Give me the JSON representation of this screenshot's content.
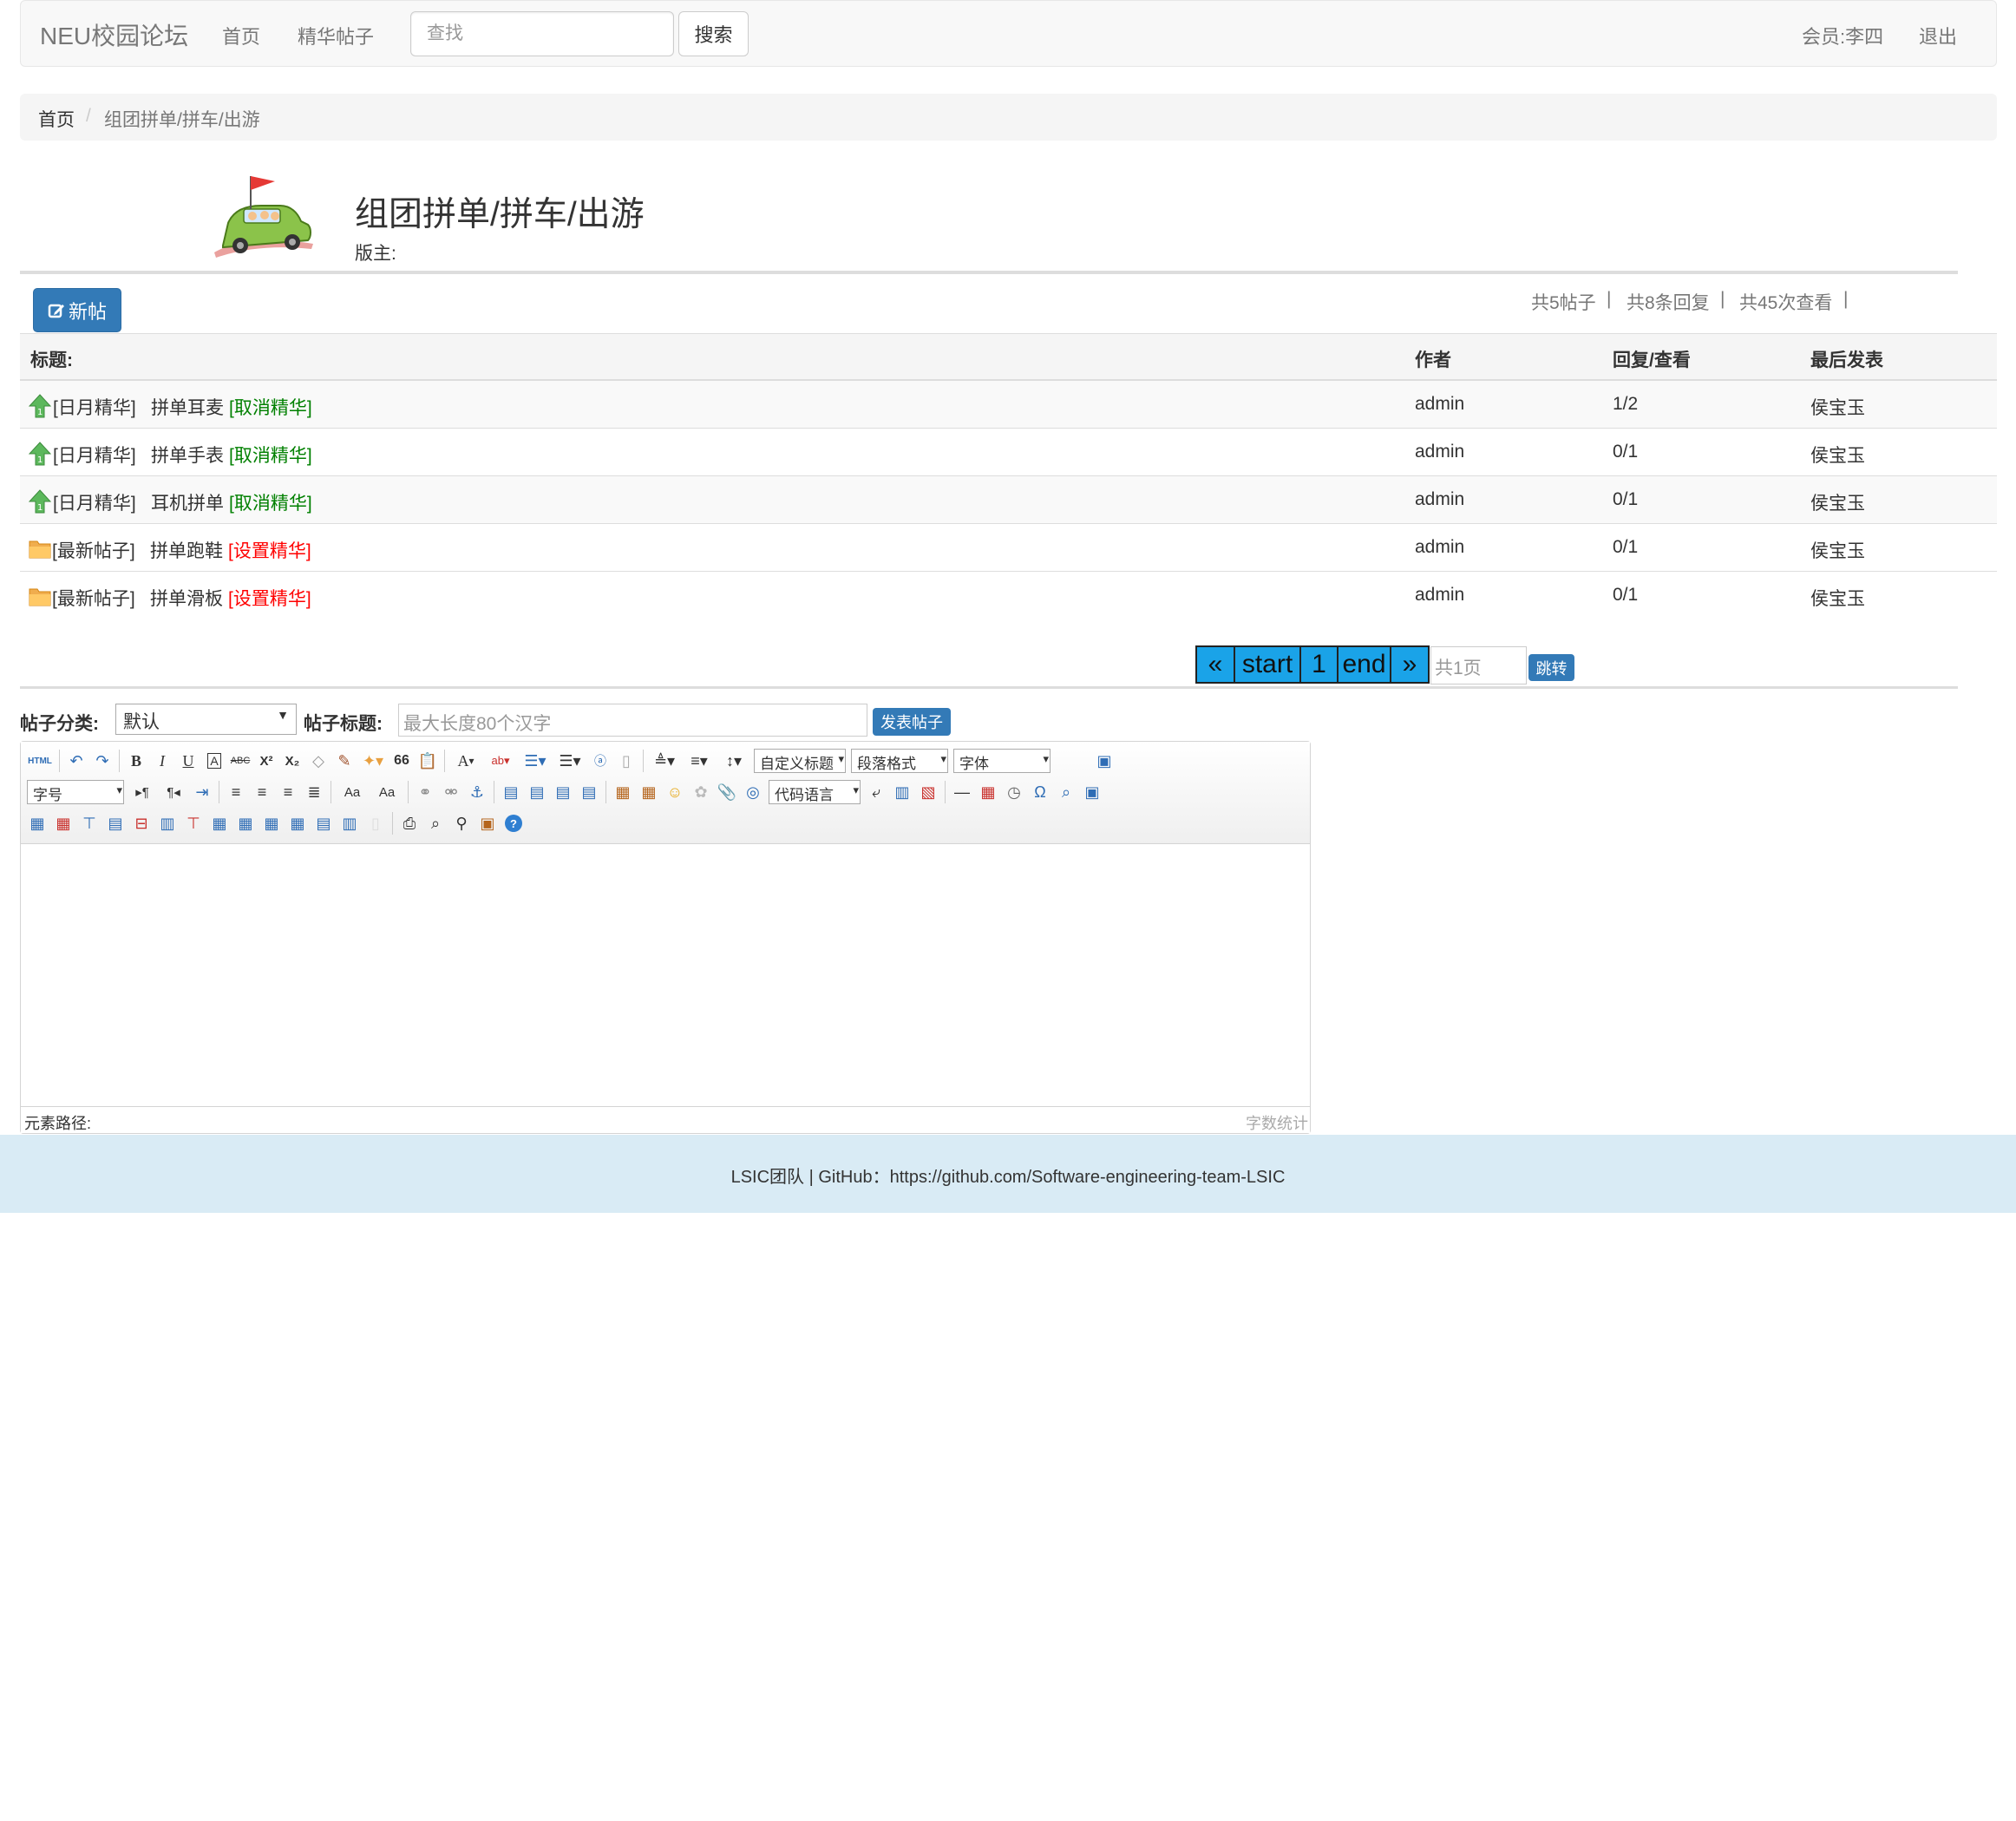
{
  "nav": {
    "brand": "NEU校园论坛",
    "home": "首页",
    "featured": "精华帖子",
    "search_placeholder": "查找",
    "search_button": "搜索",
    "member": "会员:李四",
    "logout": "退出"
  },
  "breadcrumb": {
    "home": "首页",
    "separator": "/",
    "current": "组团拼单/拼车/出游"
  },
  "board": {
    "title": "组团拼单/拼车/出游",
    "moderator": "版主:"
  },
  "toolbar": {
    "new_post": "新帖",
    "stats": [
      "共5帖子",
      "共8条回复",
      "共45次查看"
    ],
    "stat_separator": "|"
  },
  "table": {
    "headers": {
      "title": "标题:",
      "author": "作者",
      "reply_view": "回复/查看",
      "last_post": "最后发表"
    },
    "rows": [
      {
        "tag": "[日月精华]",
        "title": "拼单耳麦",
        "action": "[取消精华]",
        "author": "admin",
        "replies": "1/2",
        "last": "侯宝玉",
        "icon": "featured-up-arrow-icon"
      },
      {
        "tag": "[日月精华]",
        "title": "拼单手表",
        "action": "[取消精华]",
        "author": "admin",
        "replies": "0/1",
        "last": "侯宝玉",
        "icon": "featured-up-arrow-icon"
      },
      {
        "tag": "[日月精华]",
        "title": "耳机拼单",
        "action": "[取消精华]",
        "author": "admin",
        "replies": "0/1",
        "last": "侯宝玉",
        "icon": "featured-up-arrow-icon"
      },
      {
        "tag": "[最新帖子]",
        "title": "拼单跑鞋",
        "action": "[设置精华]",
        "author": "admin",
        "replies": "0/1",
        "last": "侯宝玉",
        "icon": "folder-icon"
      },
      {
        "tag": "[最新帖子]",
        "title": "拼单滑板",
        "action": "[设置精华]",
        "author": "admin",
        "replies": "0/1",
        "last": "侯宝玉",
        "icon": "folder-icon"
      }
    ]
  },
  "pagination": {
    "prev": "«",
    "start": "start",
    "page": "1",
    "end": "end",
    "next": "»",
    "total_placeholder": "共1页",
    "jump": "跳转"
  },
  "form": {
    "category_label": "帖子分类:",
    "category_value": "默认",
    "title_label": "帖子标题:",
    "title_placeholder": "最大长度80个汉字",
    "submit": "发表帖子"
  },
  "editor": {
    "custom_heading": "自定义标题",
    "paragraph_format": "段落格式",
    "font_family": "字体",
    "font_size": "字号",
    "code_language": "代码语言",
    "element_path": "元素路径:",
    "word_count": "字数统计",
    "glyphs": {
      "html": "HTML",
      "bold": "B",
      "italic": "I",
      "underline": "U",
      "omega": "Ω",
      "quote": "66",
      "font_color": "A",
      "superscript": "X²",
      "subscript": "X₂",
      "help": "?",
      "hr": "—"
    }
  },
  "footer": {
    "text": "LSIC团队 | GitHub：https://github.com/Software-engineering-team-LSIC"
  },
  "colors": {
    "primary": "#337ab7",
    "pager": "#1aa3e8",
    "green": "#008000",
    "red": "#ff0000",
    "footer_bg": "#d9ebf5"
  }
}
